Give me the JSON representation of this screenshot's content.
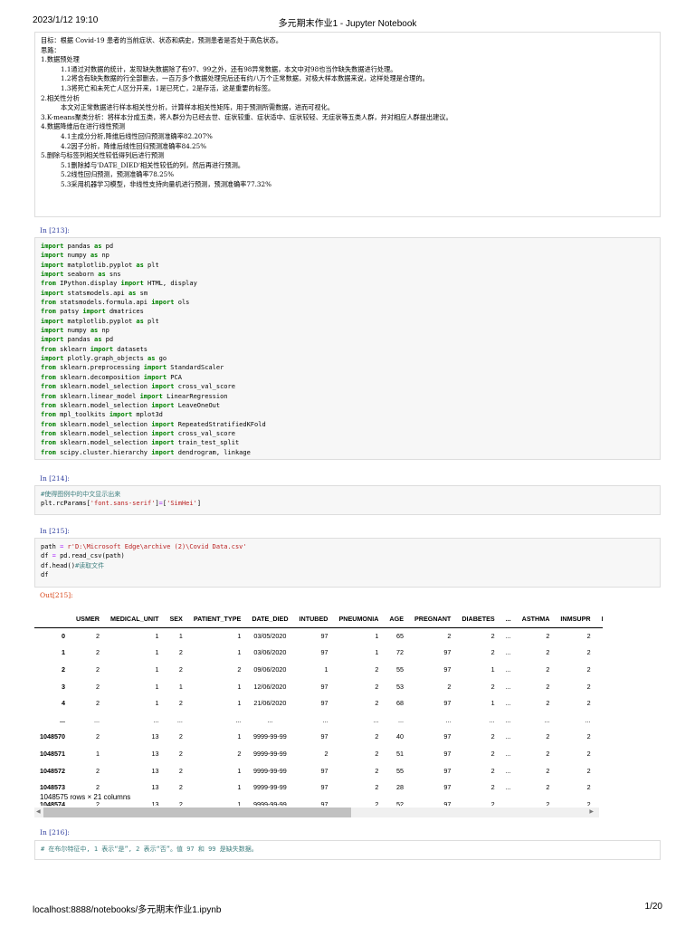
{
  "header": {
    "datetime": "2023/1/12 19:10",
    "title": "多元期末作业1 - Jupyter Notebook"
  },
  "markdown_lines": [
    {
      "indent": 0,
      "text": "目标：根据 Covid-19 患者的当前症状、状态和病史，预测患者是否处于高危状态。"
    },
    {
      "indent": 0,
      "text": "思路："
    },
    {
      "indent": 0,
      "text": "1.数据预处理"
    },
    {
      "indent": 1,
      "text": "1.1通过对数据的统计，发现缺失数据除了有97、99之外，还有98异常数据，本文中对98也当作缺失数据进行处理。"
    },
    {
      "indent": 1,
      "text": "1.2将含有缺失数据的行全部删去，一百万多个数据处理完后还有约八万个正常数据，对极大样本数据来说，这样处理是合理的。"
    },
    {
      "indent": 1,
      "text": "1.3将死亡和未死亡人区分开来，1是已死亡，2是存活，这是重要的标签。"
    },
    {
      "indent": 0,
      "text": "2.相关性分析"
    },
    {
      "indent": 1,
      "text": "本文对正常数据进行样本相关性分析，计算样本相关性矩阵，用于预测所需数据，进而可视化。"
    },
    {
      "indent": 0,
      "text": "3.K-means聚类分析：将样本分成五类，将人群分为已经去世、症状较重、症状适中、症状较轻、无症状等五类人群，并对相应人群提出建议。"
    },
    {
      "indent": 0,
      "text": "4.数据降维后在进行线性预测"
    },
    {
      "indent": 1,
      "text": "4.1主成分分析,降维后线性回归预测准确率82.207%"
    },
    {
      "indent": 1,
      "text": "4.2因子分析，降维后线性回归预测准确率84.25%"
    },
    {
      "indent": 0,
      "text": "5.删除与标签列相关性较低得列后进行预测"
    },
    {
      "indent": 1,
      "text": "5.1删除掉与'DATE_DIED'相关性较低的列，然后再进行预测。"
    },
    {
      "indent": 1,
      "text": "5.2线性回归预测，预测准确率78.25%"
    },
    {
      "indent": 1,
      "text": "5.3采用机器学习模型，非线性支持向量机进行预测，预测准确率77.32%"
    }
  ],
  "cells": [
    {
      "prompt": "In  [213]:",
      "lines": [
        [
          [
            "kw",
            "import"
          ],
          [
            "p",
            " pandas "
          ],
          [
            "kw",
            "as"
          ],
          [
            "p",
            " pd"
          ]
        ],
        [
          [
            "kw",
            "import"
          ],
          [
            "p",
            " numpy "
          ],
          [
            "kw",
            "as"
          ],
          [
            "p",
            " np"
          ]
        ],
        [
          [
            "kw",
            "import"
          ],
          [
            "p",
            " matplotlib.pyplot "
          ],
          [
            "kw",
            "as"
          ],
          [
            "p",
            " plt"
          ]
        ],
        [
          [
            "kw",
            "import"
          ],
          [
            "p",
            " seaborn "
          ],
          [
            "kw",
            "as"
          ],
          [
            "p",
            " sns"
          ]
        ],
        [
          [
            "kw",
            "from"
          ],
          [
            "p",
            " IPython.display "
          ],
          [
            "kw",
            "import"
          ],
          [
            "p",
            " HTML, display"
          ]
        ],
        [
          [
            "kw",
            "import"
          ],
          [
            "p",
            " statsmodels.api "
          ],
          [
            "kw",
            "as"
          ],
          [
            "p",
            " sm"
          ]
        ],
        [
          [
            "kw",
            "from"
          ],
          [
            "p",
            " statsmodels.formula.api "
          ],
          [
            "kw",
            "import"
          ],
          [
            "p",
            " ols"
          ]
        ],
        [
          [
            "kw",
            "from"
          ],
          [
            "p",
            " patsy "
          ],
          [
            "kw",
            "import"
          ],
          [
            "p",
            " dmatrices"
          ]
        ],
        [
          [
            "kw",
            "import"
          ],
          [
            "p",
            " matplotlib.pyplot "
          ],
          [
            "kw",
            "as"
          ],
          [
            "p",
            " plt"
          ]
        ],
        [
          [
            "kw",
            "import"
          ],
          [
            "p",
            " numpy "
          ],
          [
            "kw",
            "as"
          ],
          [
            "p",
            " np"
          ]
        ],
        [
          [
            "kw",
            "import"
          ],
          [
            "p",
            " pandas "
          ],
          [
            "kw",
            "as"
          ],
          [
            "p",
            " pd"
          ]
        ],
        [
          [
            "kw",
            "from"
          ],
          [
            "p",
            " sklearn "
          ],
          [
            "kw",
            "import"
          ],
          [
            "p",
            " datasets"
          ]
        ],
        [
          [
            "kw",
            "import"
          ],
          [
            "p",
            " plotly.graph_objects "
          ],
          [
            "kw",
            "as"
          ],
          [
            "p",
            " go"
          ]
        ],
        [
          [
            "kw",
            "from"
          ],
          [
            "p",
            " sklearn.preprocessing "
          ],
          [
            "kw",
            "import"
          ],
          [
            "p",
            " StandardScaler"
          ]
        ],
        [
          [
            "kw",
            "from"
          ],
          [
            "p",
            " sklearn.decomposition "
          ],
          [
            "kw",
            "import"
          ],
          [
            "p",
            " PCA"
          ]
        ],
        [
          [
            "kw",
            "from"
          ],
          [
            "p",
            " sklearn.model_selection "
          ],
          [
            "kw",
            "import"
          ],
          [
            "p",
            " cross_val_score"
          ]
        ],
        [
          [
            "kw",
            "from"
          ],
          [
            "p",
            " sklearn.linear_model "
          ],
          [
            "kw",
            "import"
          ],
          [
            "p",
            " LinearRegression"
          ]
        ],
        [
          [
            "kw",
            "from"
          ],
          [
            "p",
            " sklearn.model_selection "
          ],
          [
            "kw",
            "import"
          ],
          [
            "p",
            " LeaveOneOut"
          ]
        ],
        [
          [
            "kw",
            "from"
          ],
          [
            "p",
            " mpl_toolkits "
          ],
          [
            "kw",
            "import"
          ],
          [
            "p",
            " mplot3d"
          ]
        ],
        [
          [
            "kw",
            "from"
          ],
          [
            "p",
            " sklearn.model_selection "
          ],
          [
            "kw",
            "import"
          ],
          [
            "p",
            " RepeatedStratifiedKFold"
          ]
        ],
        [
          [
            "kw",
            "from"
          ],
          [
            "p",
            " sklearn.model_selection "
          ],
          [
            "kw",
            "import"
          ],
          [
            "p",
            " cross_val_score"
          ]
        ],
        [
          [
            "kw",
            "from"
          ],
          [
            "p",
            " sklearn.model_selection "
          ],
          [
            "kw",
            "import"
          ],
          [
            "p",
            " train_test_split"
          ]
        ],
        [
          [
            "kw",
            "from"
          ],
          [
            "p",
            " scipy.cluster.hierarchy "
          ],
          [
            "kw",
            "import"
          ],
          [
            "p",
            " dendrogram, linkage"
          ]
        ]
      ]
    },
    {
      "prompt": "In  [214]:",
      "lines": [
        [
          [
            "cm",
            "#使得图例中的中文显示出来"
          ]
        ],
        [
          [
            "p",
            "plt.rcParams["
          ],
          [
            "str",
            "'font.sans-serif'"
          ],
          [
            "p",
            "]"
          ],
          [
            "op",
            "="
          ],
          [
            "p",
            "["
          ],
          [
            "str",
            "'SimHei'"
          ],
          [
            "p",
            "]"
          ]
        ]
      ]
    },
    {
      "prompt": "In  [215]:",
      "lines": [
        [
          [
            "p",
            "path "
          ],
          [
            "op",
            "="
          ],
          [
            "p",
            " "
          ],
          [
            "str",
            "r'D:\\Microsoft Edge\\archive (2)\\Covid Data.csv'"
          ]
        ],
        [
          [
            "p",
            "df "
          ],
          [
            "op",
            "="
          ],
          [
            "p",
            " pd.read_csv(path)"
          ]
        ],
        [
          [
            "p",
            "df.head()"
          ],
          [
            "cm",
            "#读取文件"
          ]
        ],
        [
          [
            "p",
            "df"
          ]
        ]
      ]
    },
    {
      "prompt": "In  [216]:",
      "lines": [
        [
          [
            "cm",
            "# 在布尔特征中, 1 表示“是”, 2 表示“否”。值 97 和 99 是缺失数据。"
          ]
        ]
      ]
    }
  ],
  "output": {
    "prompt": "Out[215]:",
    "rows_info": "1048575 rows × 21 columns"
  },
  "table": {
    "columns": [
      "",
      "USMER",
      "MEDICAL_UNIT",
      "SEX",
      "PATIENT_TYPE",
      "DATE_DIED",
      "INTUBED",
      "PNEUMONIA",
      "AGE",
      "PREGNANT",
      "DIABETES",
      "...",
      "ASTHMA",
      "INMSUPR",
      "HIPE"
    ],
    "rows": [
      [
        "0",
        "2",
        "1",
        "1",
        "1",
        "03/05/2020",
        "97",
        "1",
        "65",
        "2",
        "2",
        "...",
        "2",
        "2",
        ""
      ],
      [
        "1",
        "2",
        "1",
        "2",
        "1",
        "03/06/2020",
        "97",
        "1",
        "72",
        "97",
        "2",
        "...",
        "2",
        "2",
        ""
      ],
      [
        "2",
        "2",
        "1",
        "2",
        "2",
        "09/06/2020",
        "1",
        "2",
        "55",
        "97",
        "1",
        "...",
        "2",
        "2",
        ""
      ],
      [
        "3",
        "2",
        "1",
        "1",
        "1",
        "12/06/2020",
        "97",
        "2",
        "53",
        "2",
        "2",
        "...",
        "2",
        "2",
        ""
      ],
      [
        "4",
        "2",
        "1",
        "2",
        "1",
        "21/06/2020",
        "97",
        "2",
        "68",
        "97",
        "1",
        "...",
        "2",
        "2",
        ""
      ],
      [
        "...",
        "...",
        "...",
        "...",
        "...",
        "...",
        "...",
        "...",
        "...",
        "...",
        "...",
        "...",
        "...",
        "...",
        ""
      ],
      [
        "1048570",
        "2",
        "13",
        "2",
        "1",
        "9999-99-99",
        "97",
        "2",
        "40",
        "97",
        "2",
        "...",
        "2",
        "2",
        ""
      ],
      [
        "1048571",
        "1",
        "13",
        "2",
        "2",
        "9999-99-99",
        "2",
        "2",
        "51",
        "97",
        "2",
        "...",
        "2",
        "2",
        ""
      ],
      [
        "1048572",
        "2",
        "13",
        "2",
        "1",
        "9999-99-99",
        "97",
        "2",
        "55",
        "97",
        "2",
        "...",
        "2",
        "2",
        ""
      ],
      [
        "1048573",
        "2",
        "13",
        "2",
        "1",
        "9999-99-99",
        "97",
        "2",
        "28",
        "97",
        "2",
        "...",
        "2",
        "2",
        ""
      ],
      [
        "1048574",
        "2",
        "13",
        "2",
        "1",
        "9999-99-99",
        "97",
        "2",
        "52",
        "97",
        "2",
        "...",
        "2",
        "2",
        ""
      ]
    ]
  },
  "footer": {
    "url": "localhost:8888/notebooks/多元期末作业1.ipynb",
    "page": "1/20"
  }
}
